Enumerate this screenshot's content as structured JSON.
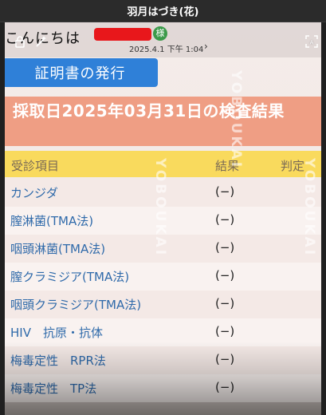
{
  "window": {
    "title": "羽月はづき(花)"
  },
  "greeting": {
    "text": "こんにちは",
    "suffix": "様"
  },
  "timestamp": "2025.4.1 下午 1:04",
  "certificate_button": {
    "label": "証明書の発行"
  },
  "result_header": {
    "title": "採取日2025年03月31日の検査結果"
  },
  "table": {
    "columns": {
      "item": "受診項目",
      "result": "結果",
      "judgment": "判定"
    },
    "rows": [
      {
        "item": "カンジダ",
        "result": "(−)"
      },
      {
        "item": "膣淋菌(TMA法)",
        "result": "(−)"
      },
      {
        "item": "咽頭淋菌(TMA法)",
        "result": "(−)"
      },
      {
        "item": "膣クラミジア(TMA法)",
        "result": "(−)"
      },
      {
        "item": "咽頭クラミジア(TMA法)",
        "result": "(−)"
      },
      {
        "item": "HIV　抗原・抗体",
        "result": "(−)"
      },
      {
        "item": "梅毒定性　RPR法",
        "result": "(−)"
      },
      {
        "item": "梅毒定性　TP法",
        "result": "(−)"
      }
    ]
  },
  "watermark": "YOBOUKAI",
  "icons": [
    "lock-rotate-icon",
    "magic-wand-icon",
    "text-recognition-icon",
    "chevron-right-icon"
  ],
  "colors": {
    "button_blue": "#2f80d8",
    "header_salmon": "#ef9e84",
    "column_yellow": "#f9da5d",
    "item_blue": "#2f6aaa"
  }
}
